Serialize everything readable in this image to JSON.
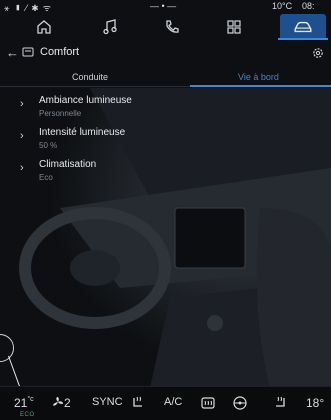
{
  "status_bar": {
    "left_icons": "⚹ ▮ ⁄ ✱ ᯤ",
    "center": "— • —",
    "temperature": "10°C",
    "time": "08:"
  },
  "top_nav": {
    "items": [
      {
        "icon": "home-icon"
      },
      {
        "icon": "music-icon"
      },
      {
        "icon": "phone-icon"
      },
      {
        "icon": "apps-icon"
      },
      {
        "icon": "car-icon",
        "active": true
      }
    ]
  },
  "header": {
    "back": "←",
    "title": "Comfort"
  },
  "tabs": [
    {
      "label": "Conduite",
      "active": false
    },
    {
      "label": "Vie à bord",
      "active": true
    }
  ],
  "settings_list": [
    {
      "title": "Ambiance lumineuse",
      "value": "Personnelle"
    },
    {
      "title": "Intensité lumineuse",
      "value": "50 %"
    },
    {
      "title": "Climatisation",
      "value": "Eco"
    }
  ],
  "bottom_bar": {
    "temp_left": "21",
    "temp_left_unit": "°c",
    "eco": "ECO",
    "fan_speed": "2",
    "sync": "SYNC",
    "ac": "A/C",
    "temp_right": "18°"
  },
  "colors": {
    "accent": "#3d86d9",
    "eco_green": "#4caf50"
  }
}
